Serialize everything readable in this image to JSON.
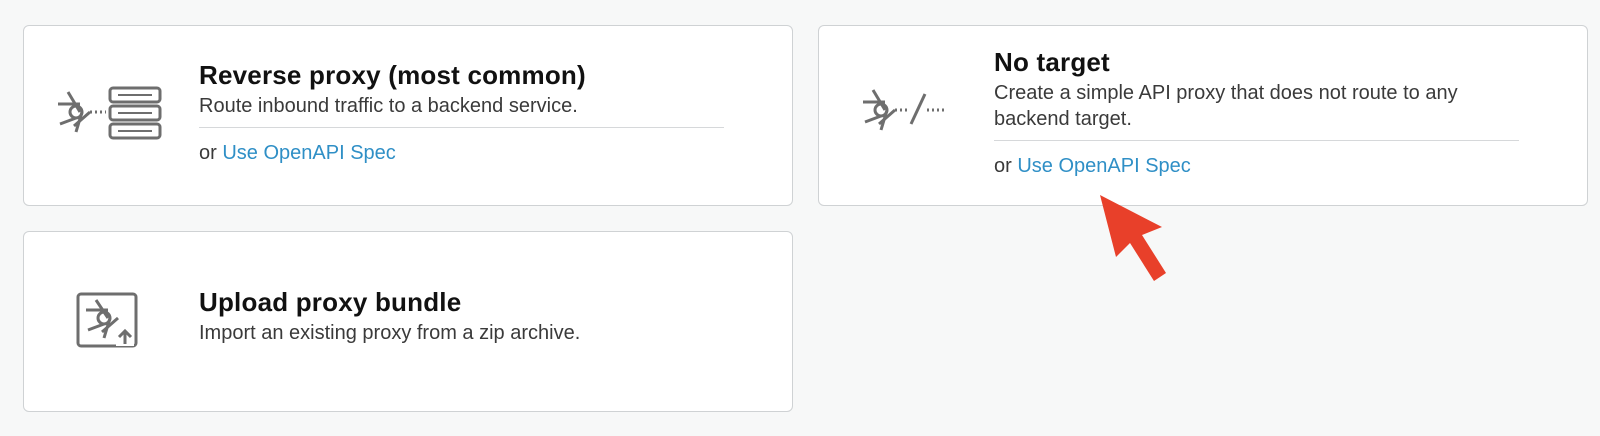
{
  "cards": [
    {
      "title": "Reverse proxy (most common)",
      "description": "Route inbound traffic to a backend service.",
      "alt_prefix": "or",
      "alt_link": "Use OpenAPI Spec",
      "icon": "reverse-proxy-icon"
    },
    {
      "title": "No target",
      "description": "Create a simple API proxy that does not route to any backend target.",
      "alt_prefix": "or",
      "alt_link": "Use OpenAPI Spec",
      "icon": "no-target-icon"
    },
    {
      "title": "Upload proxy bundle",
      "description": "Import an existing proxy from a zip archive.",
      "icon": "upload-bundle-icon"
    }
  ],
  "colors": {
    "link": "#2f8fc6",
    "icon": "#6e6e6e",
    "annotation_arrow": "#e8402a",
    "background": "#f7f8f8"
  }
}
